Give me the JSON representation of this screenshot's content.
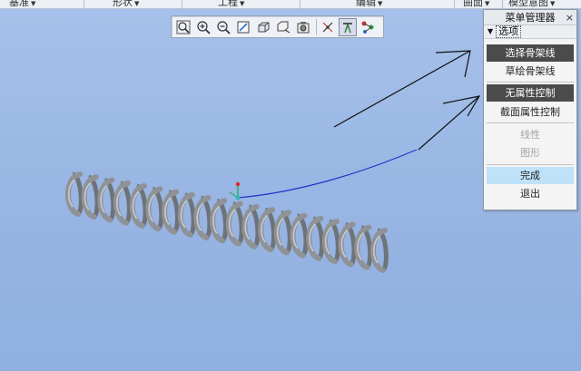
{
  "menubar": {
    "items": [
      {
        "label": "基准"
      },
      {
        "label": "形状"
      },
      {
        "label": "工程"
      },
      {
        "label": "编辑"
      },
      {
        "label": "曲面"
      },
      {
        "label": "模型意图"
      }
    ]
  },
  "toolbar": {
    "buttons": [
      {
        "icon": "zoom-fit-icon"
      },
      {
        "icon": "zoom-in-icon"
      },
      {
        "icon": "zoom-out-icon"
      },
      {
        "icon": "repaint-icon"
      },
      {
        "icon": "display-style-icon"
      },
      {
        "icon": "saved-views-icon"
      },
      {
        "icon": "view-manager-icon"
      },
      {
        "icon": "datum-display-icon"
      },
      {
        "icon": "annotation-display-icon"
      },
      {
        "icon": "spin-center-icon"
      }
    ]
  },
  "menu_manager": {
    "title": "菜单管理器",
    "section": "选项",
    "items": [
      {
        "label": "选择骨架线",
        "state": "selected"
      },
      {
        "label": "草绘骨架线",
        "state": "normal"
      },
      {
        "label": "无属性控制",
        "state": "selected"
      },
      {
        "label": "截面属性控制",
        "state": "normal"
      },
      {
        "label": "线性",
        "state": "disabled"
      },
      {
        "label": "图形",
        "state": "disabled"
      },
      {
        "label": "完成",
        "state": "hover"
      },
      {
        "label": "退出",
        "state": "normal"
      }
    ]
  },
  "colors": {
    "viewport_bg": "#9ab7e4",
    "spring": "#8f9296",
    "trajectory": "#1f35c8",
    "selected_item_bg": "#4b4b4b",
    "hover_item_bg": "#bfe2f8"
  }
}
